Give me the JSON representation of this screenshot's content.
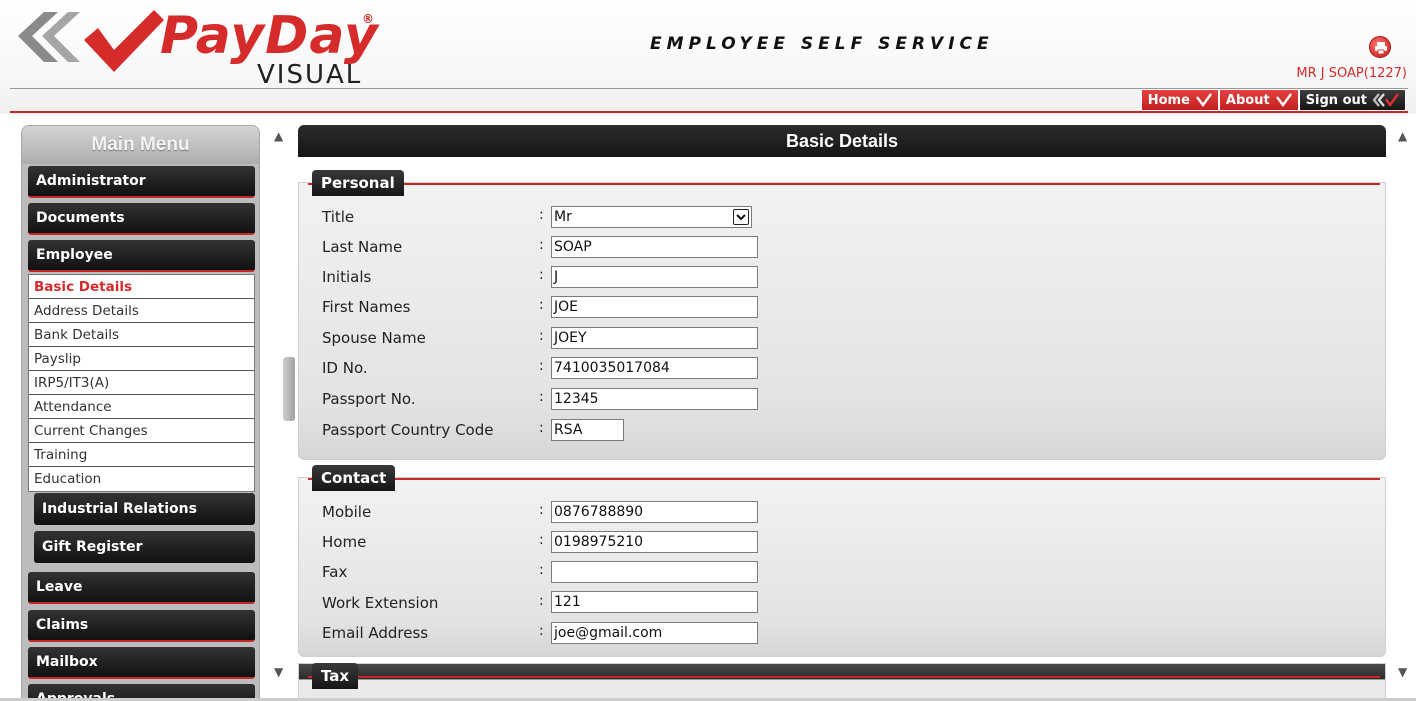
{
  "header": {
    "logo_brand": "PayDay",
    "logo_registered": "®",
    "logo_sub": "VISUAL",
    "app_title": "EMPLOYEE SELF SERVICE",
    "user": "MR J SOAP(1227)",
    "print_icon": "printer-icon",
    "nav": [
      {
        "label": "Home",
        "icon": "check-icon"
      },
      {
        "label": "About",
        "icon": "check-icon"
      },
      {
        "label": "Sign out",
        "icon": "signout-chevron-icon"
      }
    ]
  },
  "sidebar": {
    "title": "Main Menu",
    "items": [
      {
        "label": "Administrator"
      },
      {
        "label": "Documents"
      },
      {
        "label": "Employee"
      }
    ],
    "employee_links": [
      {
        "label": "Basic Details",
        "active": true
      },
      {
        "label": "Address Details"
      },
      {
        "label": "Bank Details"
      },
      {
        "label": "Payslip"
      },
      {
        "label": "IRP5/IT3(A)"
      },
      {
        "label": "Attendance"
      },
      {
        "label": "Current Changes"
      },
      {
        "label": "Training"
      },
      {
        "label": "Education"
      }
    ],
    "employee_subgroups": [
      {
        "label": "Industrial Relations"
      },
      {
        "label": "Gift Register"
      }
    ],
    "items_after": [
      {
        "label": "Leave"
      },
      {
        "label": "Claims"
      },
      {
        "label": "Mailbox"
      },
      {
        "label": "Approvals"
      }
    ]
  },
  "main": {
    "title": "Basic Details",
    "personal": {
      "heading": "Personal",
      "fields": [
        {
          "label": "Title",
          "value": "Mr",
          "type": "select"
        },
        {
          "label": "Last Name",
          "value": "SOAP"
        },
        {
          "label": "Initials",
          "value": "J"
        },
        {
          "label": "First Names",
          "value": "JOE"
        },
        {
          "label": "Spouse Name",
          "value": "JOEY"
        },
        {
          "label": "ID No.",
          "value": "7410035017084"
        },
        {
          "label": "Passport No.",
          "value": "12345"
        },
        {
          "label": "Passport Country Code",
          "value": "RSA"
        }
      ]
    },
    "contact": {
      "heading": "Contact",
      "fields": [
        {
          "label": "Mobile",
          "value": "0876788890"
        },
        {
          "label": "Home",
          "value": "0198975210"
        },
        {
          "label": "Fax",
          "value": ""
        },
        {
          "label": "Work Extension",
          "value": "121"
        },
        {
          "label": "Email Address",
          "value": "joe@gmail.com"
        }
      ]
    },
    "tax": {
      "heading": "Tax"
    }
  },
  "colon": ":",
  "colors": {
    "accent": "#c62828",
    "dark": "#1a1a1a",
    "panel": "#e6e6e6"
  }
}
